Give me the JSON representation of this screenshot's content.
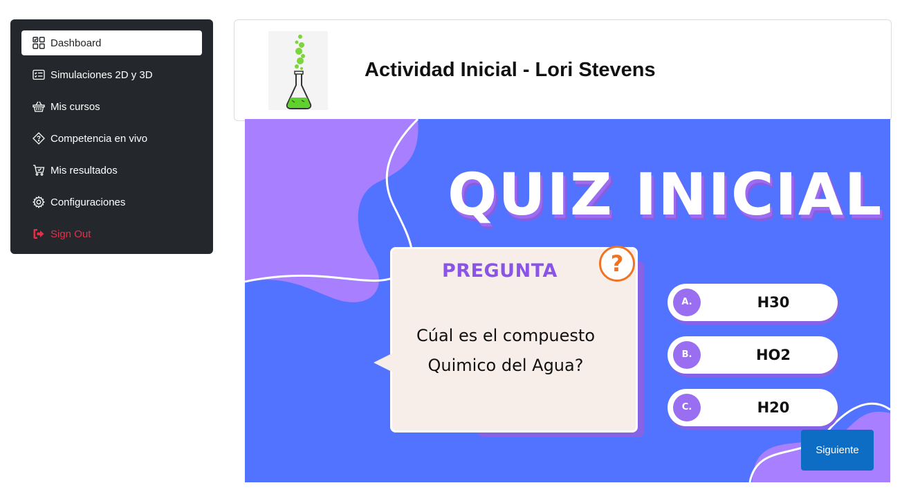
{
  "sidebar": {
    "items": [
      {
        "label": "Dashboard",
        "icon": "dashboard-icon"
      },
      {
        "label": "Simulaciones 2D y 3D",
        "icon": "checklist-icon"
      },
      {
        "label": "Mis cursos",
        "icon": "basket-icon"
      },
      {
        "label": "Competencia en vivo",
        "icon": "question-diamond-icon"
      },
      {
        "label": "Mis resultados",
        "icon": "cart-check-icon"
      },
      {
        "label": "Configuraciones",
        "icon": "gear-icon"
      },
      {
        "label": "Sign Out",
        "icon": "sign-out-icon"
      }
    ]
  },
  "header": {
    "title": "Actividad Inicial - Lori Stevens"
  },
  "quiz": {
    "title": "QUIZ INICIAL",
    "card_label": "PREGUNTA",
    "question_line1": "Cúal es el compuesto",
    "question_line2": "Quimico del Agua?",
    "qmark": "?",
    "options": [
      {
        "letter": "A.",
        "text": "H30"
      },
      {
        "letter": "B.",
        "text": "HO2"
      },
      {
        "letter": "C.",
        "text": "H20"
      }
    ]
  },
  "actions": {
    "next_label": "Siguiente"
  },
  "colors": {
    "sidebar_bg": "#24282c",
    "quiz_bg": "#5173ff",
    "accent_purple": "#9a6ef0",
    "signout_red": "#e0314b",
    "button_blue": "#0d6cc4"
  }
}
